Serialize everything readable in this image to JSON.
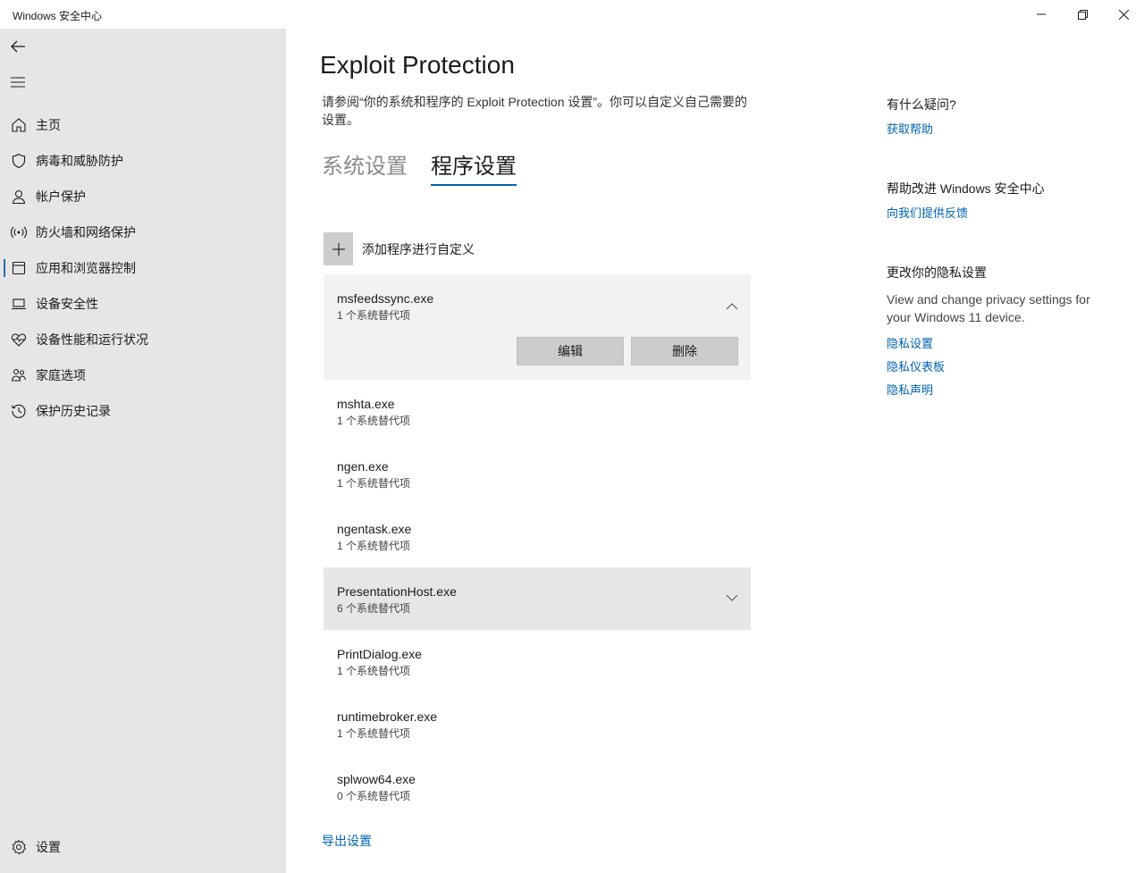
{
  "window": {
    "title": "Windows 安全中心",
    "controls": {
      "minimize": "minimize-icon",
      "restore": "restore-icon",
      "close": "close-icon"
    }
  },
  "sidebar": {
    "items": [
      {
        "label": "主页",
        "icon": "home-icon"
      },
      {
        "label": "病毒和威胁防护",
        "icon": "shield-icon"
      },
      {
        "label": "帐户保护",
        "icon": "person-icon"
      },
      {
        "label": "防火墙和网络保护",
        "icon": "wifi-icon"
      },
      {
        "label": "应用和浏览器控制",
        "icon": "app-browser-icon",
        "selected": true
      },
      {
        "label": "设备安全性",
        "icon": "laptop-icon"
      },
      {
        "label": "设备性能和运行状况",
        "icon": "heart-pulse-icon"
      },
      {
        "label": "家庭选项",
        "icon": "family-icon"
      },
      {
        "label": "保护历史记录",
        "icon": "history-icon"
      }
    ],
    "settings_label": "设置"
  },
  "main": {
    "title": "Exploit Protection",
    "description": "请参阅“你的系统和程序的 Exploit Protection 设置”。你可以自定义自己需要的设置。",
    "tabs": [
      {
        "label": "系统设置",
        "active": false
      },
      {
        "label": "程序设置",
        "active": true
      }
    ],
    "add_label": "添加程序进行自定义",
    "programs": [
      {
        "name": "msfeedssync.exe",
        "overrides": "1 个系统替代项",
        "expanded": true
      },
      {
        "name": "mshta.exe",
        "overrides": "1 个系统替代项"
      },
      {
        "name": "ngen.exe",
        "overrides": "1 个系统替代项"
      },
      {
        "name": "ngentask.exe",
        "overrides": "1 个系统替代项"
      },
      {
        "name": "PresentationHost.exe",
        "overrides": "6 个系统替代项",
        "hover": true
      },
      {
        "name": "PrintDialog.exe",
        "overrides": "1 个系统替代项"
      },
      {
        "name": "runtimebroker.exe",
        "overrides": "1 个系统替代项"
      },
      {
        "name": "splwow64.exe",
        "overrides": "0 个系统替代项"
      }
    ],
    "edit_label": "编辑",
    "delete_label": "删除",
    "export_label": "导出设置"
  },
  "aside": {
    "help_heading": "有什么疑问?",
    "help_link": "获取帮助",
    "improve_heading": "帮助改进 Windows 安全中心",
    "feedback_link": "向我们提供反馈",
    "privacy_heading": "更改你的隐私设置",
    "privacy_text": "View and change privacy settings for your Windows 11 device.",
    "privacy_links": [
      "隐私设置",
      "隐私仪表板",
      "隐私声明"
    ]
  },
  "colors": {
    "accent": "#0063b1",
    "sidebar_bg": "#e6e6e6",
    "selected_bar": "#2b6cb0"
  }
}
